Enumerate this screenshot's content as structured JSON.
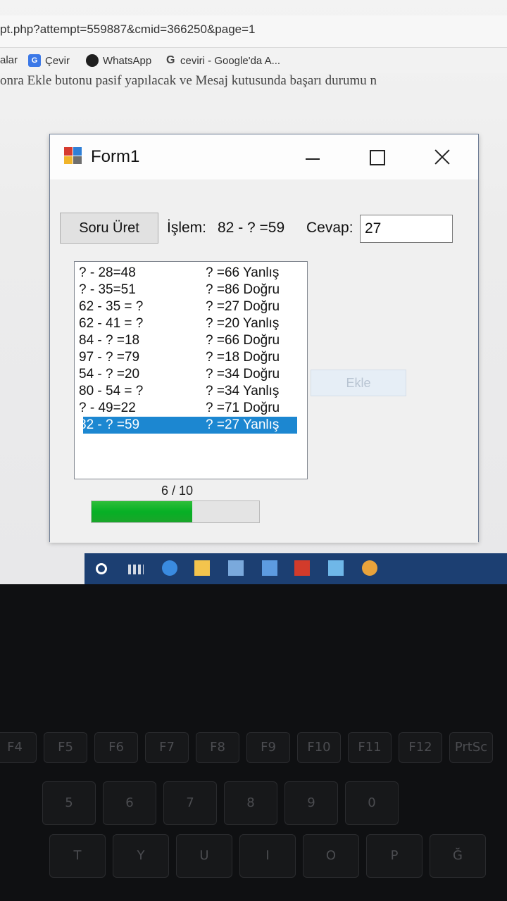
{
  "browser": {
    "url_text": "pt.php?attempt=559887&cmid=366250&page=1",
    "bookmarks": [
      {
        "label": "alar"
      },
      {
        "label": "Çevir",
        "icon": "translate-icon"
      },
      {
        "label": "WhatsApp",
        "icon": "whatsapp-icon"
      },
      {
        "label": "ceviri - Google'da A...",
        "icon": "google-icon"
      }
    ],
    "page_text": "onra Ekle butonu pasif yapılacak ve Mesaj kutusunda başarı durumu n"
  },
  "form": {
    "title": "Form1",
    "generate_button": "Soru Üret",
    "islem_label": "İşlem:",
    "current_question": "82 - ? =59",
    "cevap_label": "Cevap:",
    "answer_value": "27",
    "add_button": "Ekle",
    "add_enabled": false,
    "list": [
      {
        "question": "? - 28=48",
        "result": "? =66 Yanlış"
      },
      {
        "question": "? - 35=51",
        "result": "? =86 Doğru"
      },
      {
        "question": "62 - 35 = ?",
        "result": "? =27 Doğru"
      },
      {
        "question": "62 - 41 = ?",
        "result": "? =20 Yanlış"
      },
      {
        "question": "84 - ? =18",
        "result": "? =66 Doğru"
      },
      {
        "question": "97 - ? =79",
        "result": "? =18 Doğru"
      },
      {
        "question": "54 - ? =20",
        "result": "? =34 Doğru"
      },
      {
        "question": "80 - 54 = ?",
        "result": "? =34 Yanlış"
      },
      {
        "question": "? - 49=22",
        "result": "? =71 Doğru"
      },
      {
        "question": "82 - ? =59",
        "result": "? =27 Yanlış",
        "selected": true
      }
    ],
    "progress_label": "6 / 10",
    "progress_fraction": 0.6
  },
  "taskbar": {
    "icons": [
      "start-icon",
      "task-view-icon",
      "edge-icon",
      "file-explorer-icon",
      "store-icon",
      "mail-icon",
      "office-icon",
      "app-icon",
      "chrome-icon"
    ]
  },
  "keyboard": {
    "keys_row1": [
      "F4",
      "F5",
      "F6",
      "F7",
      "F8",
      "F9",
      "F10",
      "F11",
      "F12",
      "PrtSc"
    ],
    "keys_row2": [
      "5",
      "6",
      "7",
      "8",
      "9",
      "0"
    ],
    "keys_row3": [
      "T",
      "Y",
      "U",
      "I",
      "O",
      "P",
      "Ğ"
    ]
  }
}
